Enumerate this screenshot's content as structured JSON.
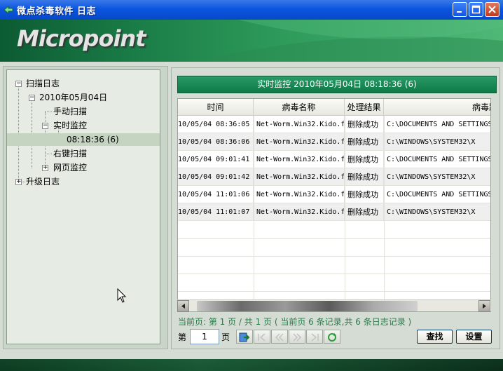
{
  "window": {
    "title": "微点杀毒软件  日志"
  },
  "banner": {
    "logo": "Micropoint"
  },
  "tree": {
    "scan_log": "扫描日志",
    "date": "2010年05月04日",
    "manual_scan": "手动扫描",
    "realtime_monitor": "实时监控",
    "time_entry": "08:18:36 (6)",
    "right_click_scan": "右键扫描",
    "web_monitor": "网页监控",
    "upgrade_log": "升级日志"
  },
  "monitor_header": "实时监控 2010年05月04日 08:18:36 (6)",
  "table": {
    "columns": [
      "时间",
      "病毒名称",
      "处理结果",
      "病毒路径"
    ],
    "rows": [
      {
        "time": "10/05/04 08:36:05",
        "name": "Net-Worm.Win32.Kido.f",
        "result": "删除成功",
        "path": "C:\\DOCUMENTS AND SETTINGS"
      },
      {
        "time": "10/05/04 08:36:06",
        "name": "Net-Worm.Win32.Kido.f",
        "result": "删除成功",
        "path": "C:\\WINDOWS\\SYSTEM32\\X"
      },
      {
        "time": "10/05/04 09:01:41",
        "name": "Net-Worm.Win32.Kido.f",
        "result": "删除成功",
        "path": "C:\\DOCUMENTS AND SETTINGS"
      },
      {
        "time": "10/05/04 09:01:42",
        "name": "Net-Worm.Win32.Kido.f",
        "result": "删除成功",
        "path": "C:\\WINDOWS\\SYSTEM32\\X"
      },
      {
        "time": "10/05/04 11:01:06",
        "name": "Net-Worm.Win32.Kido.f",
        "result": "删除成功",
        "path": "C:\\DOCUMENTS AND SETTINGS"
      },
      {
        "time": "10/05/04 11:01:07",
        "name": "Net-Worm.Win32.Kido.f",
        "result": "删除成功",
        "path": "C:\\WINDOWS\\SYSTEM32\\X"
      }
    ]
  },
  "pagination": {
    "info": "当前页: 第 1 页 / 共 1 页 ( 当前页 6 条记录,共 6 条日志记录 )",
    "label_prefix": "第",
    "page_value": "1",
    "label_suffix": "页"
  },
  "buttons": {
    "find": "查找",
    "settings": "设置"
  },
  "colors": {
    "header_green": "#0d7a48",
    "info_green": "#2a7a4a",
    "titlebar_blue": "#0a56e0"
  }
}
